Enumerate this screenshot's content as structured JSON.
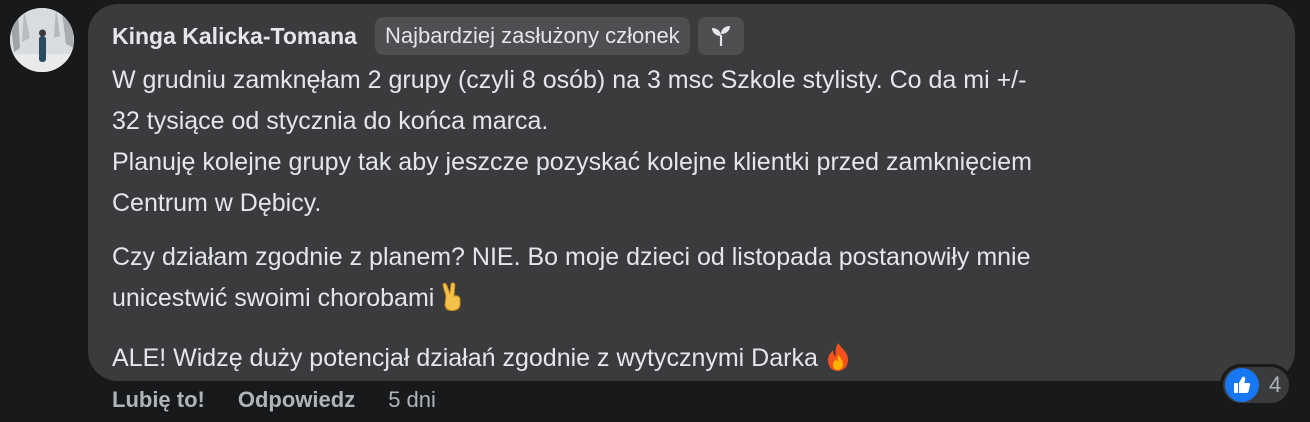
{
  "comment": {
    "author": "Kinga Kalicka-Tomana",
    "badge": "Najbardziej zasłużony członek",
    "badge_icon": "sprout-icon",
    "paragraphs": [
      [
        "W grudniu zamknęłam 2 grupy (czyli 8 osób) na 3 msc Szkole stylisty. Co da mi +/-",
        "32 tysiące od stycznia do końca marca.",
        "Planuję kolejne grupy tak aby jeszcze pozyskać kolejne klientki przed zamknięciem",
        "Centrum w Dębicy."
      ],
      [
        "Czy działam zgodnie z planem? NIE. Bo moje dzieci od listopada postanowiły mnie",
        "unicestwić swoimi chorobami"
      ],
      [
        "ALE! Widzę duży potencjał działań zgodnie z wytycznymi Darka"
      ]
    ],
    "emoji": {
      "victory": "victory-hand-emoji",
      "fire": "fire-emoji"
    },
    "reactions": {
      "icon": "thumbs-up-icon",
      "count": "4",
      "color": "#1877f2"
    },
    "actions": {
      "like": "Lubię to!",
      "reply": "Odpowiedz",
      "time": "5 dni"
    }
  },
  "colors": {
    "background": "#18191a",
    "bubble": "#3a3b3c",
    "text": "#e4e6eb",
    "muted": "#b0b3b8"
  }
}
